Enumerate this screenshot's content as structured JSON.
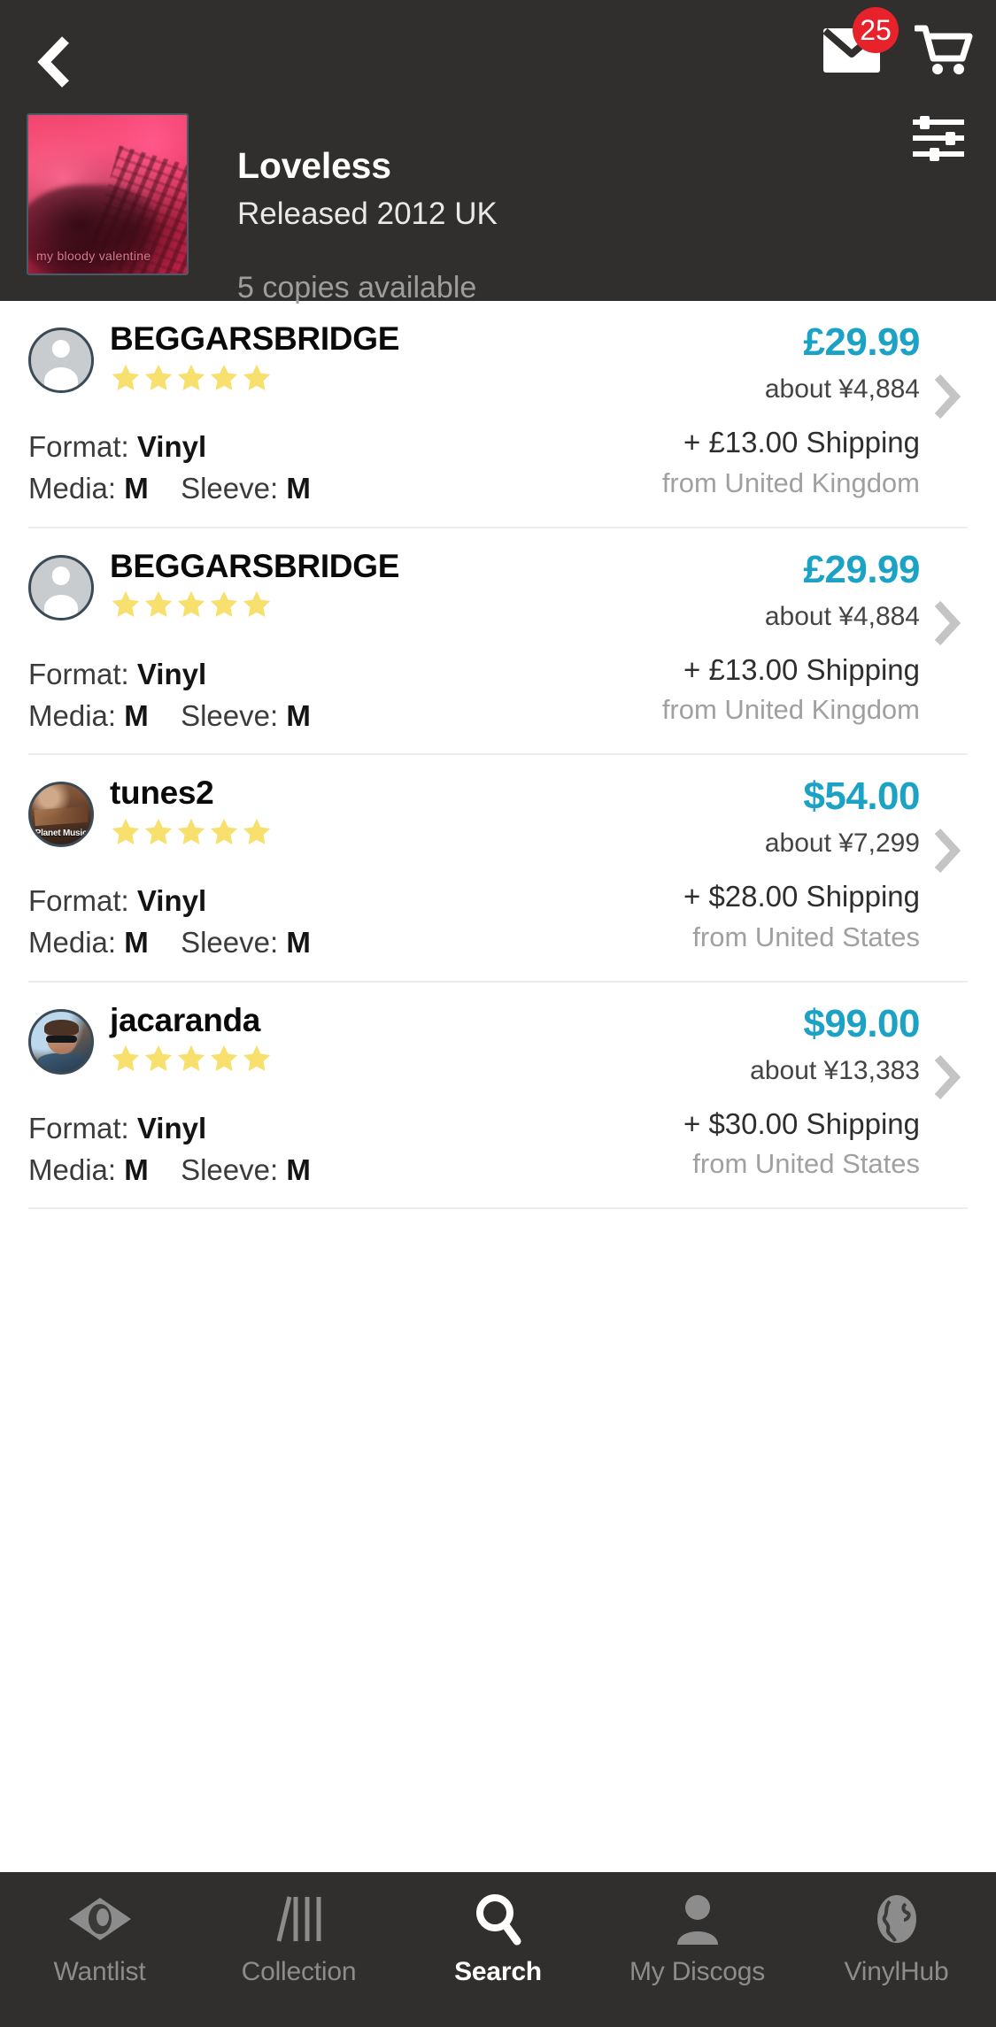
{
  "header": {
    "back_icon": "chevron-left-icon",
    "messages_icon": "envelope-icon",
    "messages_badge": "25",
    "cart_icon": "shopping-cart-icon",
    "filter_icon": "sliders-filter-icon",
    "release": {
      "cover_watermark": "my bloody valentine",
      "title": "Loveless",
      "released": "Released 2012 UK",
      "copies": "5 copies available"
    }
  },
  "listings": [
    {
      "seller": "BEGGARSBRIDGE",
      "avatar_type": "generic",
      "avatar_label": "",
      "rating_stars": 5,
      "price": "£29.99",
      "price_approx": "about ¥4,884",
      "format_label": "Format:",
      "format_value": "Vinyl",
      "media_label": "Media:",
      "media_value": "M",
      "sleeve_label": "Sleeve:",
      "sleeve_value": "M",
      "shipping": "+ £13.00 Shipping",
      "ships_from": "from United Kingdom",
      "chevron_icon": "chevron-right-icon"
    },
    {
      "seller": "BEGGARSBRIDGE",
      "avatar_type": "generic",
      "avatar_label": "",
      "rating_stars": 5,
      "price": "£29.99",
      "price_approx": "about ¥4,884",
      "format_label": "Format:",
      "format_value": "Vinyl",
      "media_label": "Media:",
      "media_value": "M",
      "sleeve_label": "Sleeve:",
      "sleeve_value": "M",
      "shipping": "+ £13.00 Shipping",
      "ships_from": "from United Kingdom",
      "chevron_icon": "chevron-right-icon"
    },
    {
      "seller": "tunes2",
      "avatar_type": "shop",
      "avatar_label": "Planet Music",
      "rating_stars": 5,
      "price": "$54.00",
      "price_approx": "about ¥7,299",
      "format_label": "Format:",
      "format_value": "Vinyl",
      "media_label": "Media:",
      "media_value": "M",
      "sleeve_label": "Sleeve:",
      "sleeve_value": "M",
      "shipping": "+ $28.00 Shipping",
      "ships_from": "from United States",
      "chevron_icon": "chevron-right-icon"
    },
    {
      "seller": "jacaranda",
      "avatar_type": "person",
      "avatar_label": "",
      "rating_stars": 5,
      "price": "$99.00",
      "price_approx": "about ¥13,383",
      "format_label": "Format:",
      "format_value": "Vinyl",
      "media_label": "Media:",
      "media_value": "M",
      "sleeve_label": "Sleeve:",
      "sleeve_value": "M",
      "shipping": "+ $30.00 Shipping",
      "ships_from": "from United States",
      "chevron_icon": "chevron-right-icon"
    }
  ],
  "tabbar": {
    "items": [
      {
        "label": "Wantlist",
        "icon": "eye-icon",
        "active": false
      },
      {
        "label": "Collection",
        "icon": "records-icon",
        "active": false
      },
      {
        "label": "Search",
        "icon": "magnifier-icon",
        "active": true
      },
      {
        "label": "My Discogs",
        "icon": "person-icon",
        "active": false
      },
      {
        "label": "VinylHub",
        "icon": "globe-icon",
        "active": false
      }
    ]
  },
  "colors": {
    "header_bg": "#302f2d",
    "price_accent": "#1ba2c4",
    "badge_red": "#e8222a",
    "star_yellow": "#f7e06e",
    "muted_text": "#a0a0a0"
  }
}
